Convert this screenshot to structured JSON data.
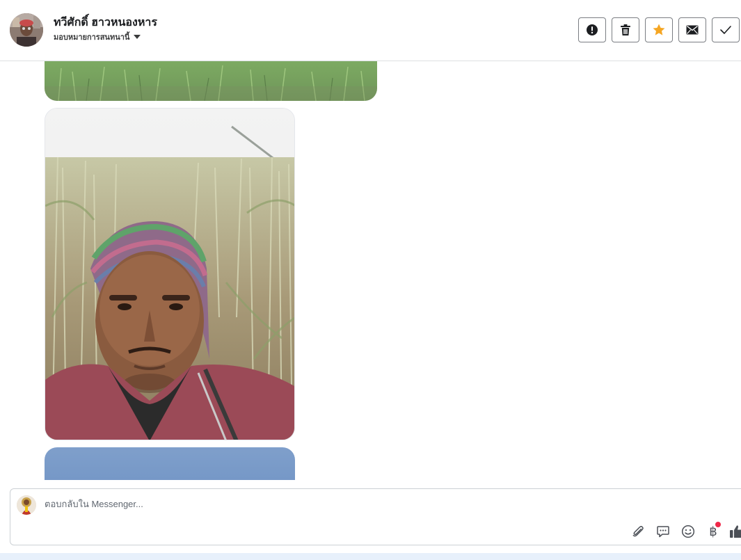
{
  "header": {
    "contact_name": "ทวีศักดิ์ ฮาวหนองหาร",
    "assign_label": "มอบหมายการสนทนานี้",
    "actions": [
      {
        "name": "spam-button",
        "icon": "alert-circle-icon"
      },
      {
        "name": "delete-button",
        "icon": "trash-icon"
      },
      {
        "name": "star-button",
        "icon": "star-icon",
        "color": "#f5a623"
      },
      {
        "name": "mark-unread-button",
        "icon": "envelope-icon"
      },
      {
        "name": "mark-done-button",
        "icon": "checkmark-icon"
      }
    ]
  },
  "messages": [
    {
      "type": "image",
      "subject": "green-grass-field"
    },
    {
      "type": "image",
      "subject": "man-in-sugarcane-field-selfie"
    },
    {
      "type": "image",
      "subject": "blue-sky"
    }
  ],
  "composer": {
    "placeholder": "ตอบกลับใน Messenger...",
    "tools": [
      "paperclip-icon",
      "saved-reply-icon",
      "emoji-icon",
      "baht-payment-icon",
      "thumbs-up-icon"
    ],
    "baht_symbol": "฿",
    "notification_color": "#f02849"
  },
  "colors": {
    "border": "#dddfe2",
    "icon": "#4b4f56",
    "accent_star": "#f5a623"
  }
}
